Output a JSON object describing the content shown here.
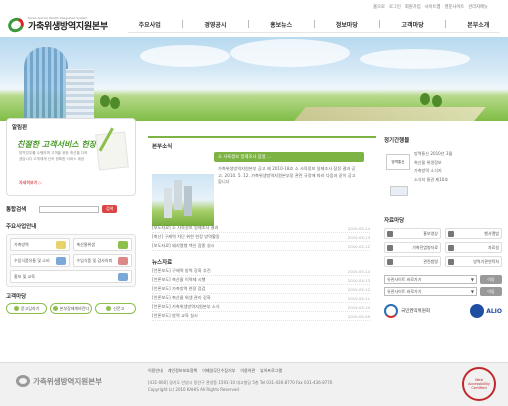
{
  "header": {
    "logo_text": "가축위생방역지원본부",
    "logo_sub": "Korea Animal Health Integrated System",
    "top_links": [
      "홈으로",
      "로그인",
      "회원가입",
      "사이트맵",
      "영문사이트",
      "관리자메뉴"
    ],
    "nav": [
      "주요사업",
      "경영공시",
      "홍보뉴스",
      "정보마당",
      "고객마당",
      "본부소개"
    ]
  },
  "left": {
    "notice_title": "알림판",
    "promo_head": "친절한 고객서비스 헌장",
    "promo_body": "방역업무를 수행하며 고객을 위한 최선을 다하겠습니다 고객에게 신속 정확한 서비스 제공",
    "promo_more": "자세히보기 ▷",
    "search_title": "통합검색",
    "search_button": "검색",
    "guide_title": "주요사업안내",
    "guide_items": [
      "가축방역",
      "축산물위생",
      "수입식품유통 및 소비",
      "수입식품 및 검사의뢰"
    ],
    "guide_full_item": "홍보 및 교육",
    "cust_title": "고객마당",
    "cust_items": [
      "묻고답하기",
      "본부장에게바란다",
      "신문고"
    ]
  },
  "center": {
    "news_title": "본부소식",
    "news_badge": "소 사육정보 일제조사 잠정 ...",
    "news_text": "가축위생방역지원본부 공고 제 2010-18호 소 사육정보 일제조사 잠정 결과 공고. 2010. 5. 12. 가축위생방역지원본부장 관련 규정에 따라 다음과 같이 공고합니다",
    "news_list": [
      {
        "cat": "[보도자료]",
        "title": "[보도자료] 소 사육정보 일제조사 결과",
        "date": "2010-05-14"
      },
      {
        "cat": "[보도자료]",
        "title": "[축산] 구제역 차단 위한 현장 방역활동",
        "date": "2010-05-13"
      },
      {
        "cat": "[보도자료]",
        "title": "[보도자료] 돼지열병 백신 접종 실시",
        "date": "2010-05-12"
      },
      {
        "cat": "[보도자료]",
        "title": "[보도자료] 가축전염병 예방 홍보 캠페인",
        "date": "2010-05-11"
      }
    ],
    "data_title": "뉴스자료",
    "data_list": [
      {
        "cat": "[언론보도]",
        "title": "[언론보도] 구제역 방역 강화 추진",
        "date": "2010-05-14"
      },
      {
        "cat": "[언론보도]",
        "title": "[언론보도] 축산물 이력제 시행",
        "date": "2010-05-13"
      },
      {
        "cat": "[언론보도]",
        "title": "[언론보도] 가축방역 현장 점검",
        "date": "2010-05-12"
      },
      {
        "cat": "[언론보도]",
        "title": "[언론보도] 축산물 위생 관리 강화",
        "date": "2010-05-11"
      },
      {
        "cat": "[언론보도]",
        "title": "[언론보도] 가축위생방역지원본부 소식",
        "date": "2010-05-10"
      },
      {
        "cat": "[언론보도]",
        "title": "[언론보도] 방역 교육 실시",
        "date": "2010-05-09"
      }
    ]
  },
  "right": {
    "pub_title": "정기간행물",
    "pub_thumb": "방역통신",
    "pub_items": [
      "방역통신 2010년 3월",
      "축산물 위생정보",
      "가축방역 소식지",
      "소식지 통권 제10호"
    ],
    "data_title": "자료마당",
    "data_items": [
      "홍보영상",
      "행사앨범",
      "가축전염병자료",
      "자료실",
      "관련법령",
      "방역기관연락처"
    ],
    "select1": "유관사이트 바로가기",
    "select2": "유관사이트 바로가기",
    "go_label": "이동",
    "banner1": "국민권익위원회",
    "banner2": "ALIO"
  },
  "footer": {
    "links": [
      "이용안내",
      "개인정보보호정책",
      "이메일무단수집거부",
      "이용약관",
      "뷰어프로그램"
    ],
    "address": "[431-060] 경기도 안양시 동안구 관양동 1591-10 대고빌딩 5층 Tel 031-436-8770 Fax 031-436-8776",
    "copyright": "Copyright (c) 2010 KAHIS All Rights Reserved",
    "seal": "Web Accessibility Certified"
  }
}
